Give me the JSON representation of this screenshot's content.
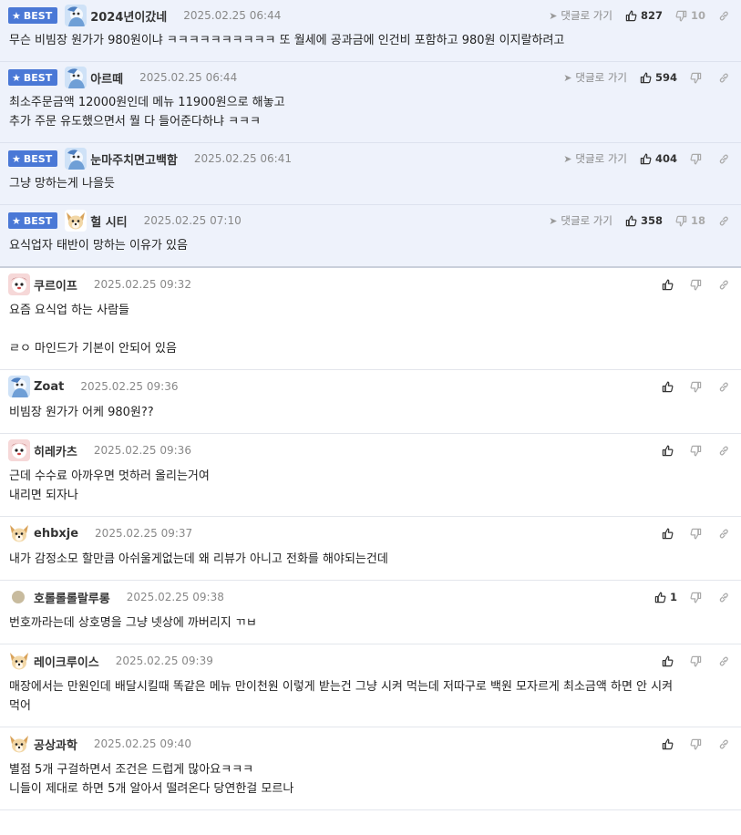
{
  "badge_label": "BEST",
  "goto_label": "댓글로 가기",
  "best": [
    {
      "nick": "2024년이갔네",
      "date": "2025.02.25 06:44",
      "body": "무슨 비빔장 원가가 980원이냐 ㅋㅋㅋㅋㅋㅋㅋㅋㅋㅋ 또 월세에 공과금에 인건비 포함하고 980원 이지랄하려고",
      "up": "827",
      "down": "10",
      "avatar": "blue"
    },
    {
      "nick": "아르떼",
      "date": "2025.02.25 06:44",
      "body": "최소주문금액 12000원인데 메뉴 11900원으로 해놓고\n추가 주문 유도했으면서 뭘 다 들어준다하냐 ㅋㅋㅋ",
      "up": "594",
      "down": "",
      "avatar": "blue"
    },
    {
      "nick": "눈마주치면고백함",
      "date": "2025.02.25 06:41",
      "body": "그냥 망하는게 나을듯",
      "up": "404",
      "down": "",
      "avatar": "blue"
    },
    {
      "nick": "헐 시티",
      "date": "2025.02.25 07:10",
      "body": "요식업자 태반이 망하는 이유가 있음",
      "up": "358",
      "down": "18",
      "avatar": "dog"
    }
  ],
  "comments": [
    {
      "nick": "쿠르이프",
      "date": "2025.02.25 09:32",
      "body": "요즘 요식업 하는 사람들\n\nㄹㅇ 마인드가 기본이 안되어 있음",
      "up": "",
      "down": "",
      "avatar": "pink"
    },
    {
      "nick": "Zoat",
      "date": "2025.02.25 09:36",
      "body": "비빔장 원가가 어케 980원??",
      "up": "",
      "down": "",
      "avatar": "blue"
    },
    {
      "nick": "히레카츠",
      "date": "2025.02.25 09:36",
      "body": "근데 수수료 아까우면 멋하러 올리는거여\n내리면 되자나",
      "up": "",
      "down": "",
      "avatar": "pink"
    },
    {
      "nick": "ehbxje",
      "date": "2025.02.25 09:37",
      "body": "내가 감정소모 할만큼 아쉬울게없는데 왜 리뷰가 아니고 전화를 해야되는건데",
      "up": "",
      "down": "",
      "avatar": "dog"
    },
    {
      "nick": "호롤롤롤랄루롱",
      "date": "2025.02.25 09:38",
      "body": "번호까라는데 상호명을 그냥 넷상에 까버리지 ㄲㅂ",
      "up": "1",
      "down": "",
      "avatar": "dot"
    },
    {
      "nick": "레이크루이스",
      "date": "2025.02.25 09:39",
      "body": "매장에서는 만원인데 배달시킬때 똑같은 메뉴 만이천원 이렇게 받는건 그냥 시켜 먹는데 저따구로 백원 모자르게 최소금액 하면 안 시켜\n먹어",
      "up": "",
      "down": "",
      "avatar": "dog"
    },
    {
      "nick": "공상과학",
      "date": "2025.02.25 09:40",
      "body": "별점 5개 구걸하면서 조건은 드럽게 많아요ㅋㅋㅋ\n니들이 제대로 하면 5개 알아서 떨려온다 당연한걸 모르나",
      "up": "",
      "down": "",
      "avatar": "dog"
    }
  ]
}
